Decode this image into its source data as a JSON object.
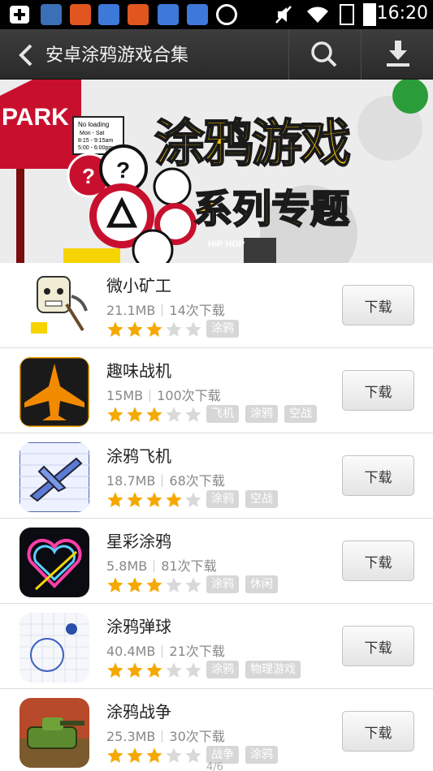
{
  "status_bar": {
    "time": "16:20",
    "icons": [
      "add-icon",
      "thermometer-icon",
      "s-app-icon",
      "baidu-icon",
      "s-app-icon",
      "baidu-icon",
      "baidu-icon",
      "sync-icon",
      "mute-icon",
      "wifi-icon",
      "sim-icon",
      "battery-icon"
    ]
  },
  "header": {
    "title": "安卓涂鸦游戏合集",
    "back_icon": "chevron-left-icon",
    "search_icon": "search-icon",
    "download_icon": "download-icon"
  },
  "banner": {
    "headline": "涂鸦游戏",
    "subheadline": "系列专题",
    "sign_park": "PARK",
    "sign_hiphop": "HIP HOP",
    "sign_noloading": "No loading",
    "sign_days": "Mon - Sat",
    "sign_time1": "8:15 - 9:15am",
    "sign_time2": "5:00 - 6:00pm"
  },
  "colors": {
    "star_filled": "#f5a800",
    "star_empty": "#d9d9d9",
    "tag_bg": "#d7d7d7",
    "headline_yellow": "#f5c400"
  },
  "apps": [
    {
      "name": "微小矿工",
      "size": "21.1MB",
      "downloads": "14次下载",
      "rating": 3,
      "tags": [
        "涂鸦"
      ],
      "button": "下载",
      "icon": "miner-icon"
    },
    {
      "name": "趣味战机",
      "size": "15MB",
      "downloads": "100次下载",
      "rating": 3,
      "tags": [
        "飞机",
        "涂鸦",
        "空战"
      ],
      "button": "下载",
      "icon": "fighter-jet-icon"
    },
    {
      "name": "涂鸦飞机",
      "size": "18.7MB",
      "downloads": "68次下载",
      "rating": 4,
      "tags": [
        "涂鸦",
        "空战"
      ],
      "button": "下载",
      "icon": "doodle-plane-icon"
    },
    {
      "name": "星彩涂鸦",
      "size": "5.8MB",
      "downloads": "81次下载",
      "rating": 3,
      "tags": [
        "涂鸦",
        "休闲"
      ],
      "button": "下载",
      "icon": "neon-heart-icon"
    },
    {
      "name": "涂鸦弹球",
      "size": "40.4MB",
      "downloads": "21次下载",
      "rating": 3,
      "tags": [
        "涂鸦",
        "物理游戏"
      ],
      "button": "下载",
      "icon": "doodle-ball-icon"
    },
    {
      "name": "涂鸦战争",
      "size": "25.3MB",
      "downloads": "30次下载",
      "rating": 3,
      "tags": [
        "战争",
        "涂鸦"
      ],
      "button": "下载",
      "icon": "tank-icon"
    }
  ],
  "page_indicator": "4/6"
}
